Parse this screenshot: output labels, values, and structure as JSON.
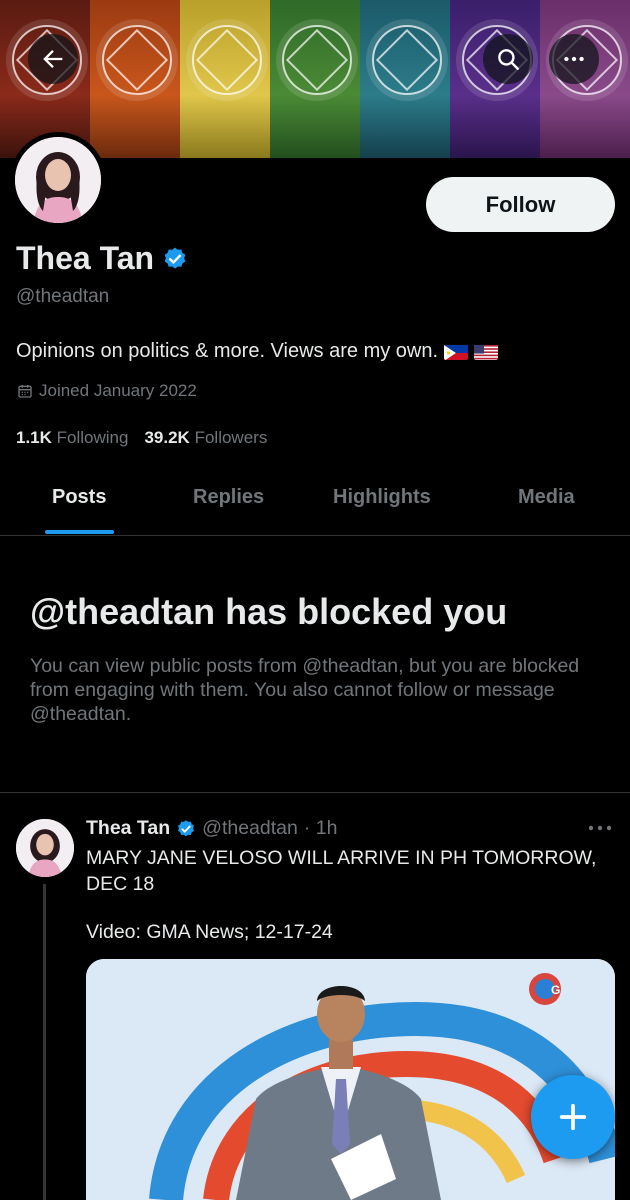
{
  "profile": {
    "name": "Thea Tan",
    "handle": "@theadtan",
    "bio": "Opinions on politics & more. Views are my own.",
    "joined": "Joined January 2022",
    "following_count": "1.1K",
    "following_label": "Following",
    "followers_count": "39.2K",
    "followers_label": "Followers",
    "follow_button": "Follow"
  },
  "tabs": [
    {
      "label": "Posts",
      "active": true
    },
    {
      "label": "Replies",
      "active": false
    },
    {
      "label": "Highlights",
      "active": false
    },
    {
      "label": "Media",
      "active": false
    }
  ],
  "blocked": {
    "title": "@theadtan has blocked you",
    "message": "You can view public posts from @theadtan, but you are blocked from engaging with them. You also cannot follow or message @theadtan."
  },
  "post": {
    "author": "Thea Tan",
    "handle": "@theadtan",
    "time": "· 1h",
    "text": "MARY JANE VELOSO WILL ARRIVE IN PH TOMORROW, DEC 18",
    "text2": "Video: GMA News; 12-17-24",
    "media_logo": "G"
  },
  "icons": {
    "back": "arrow-left-icon",
    "search": "search-icon",
    "more": "more-icon",
    "verified": "verified-badge-icon",
    "calendar": "calendar-icon",
    "compose": "plus-icon"
  },
  "colors": {
    "accent": "#1d9bf0",
    "background": "#000000",
    "text": "#e7e9ea",
    "muted": "#71767b"
  }
}
